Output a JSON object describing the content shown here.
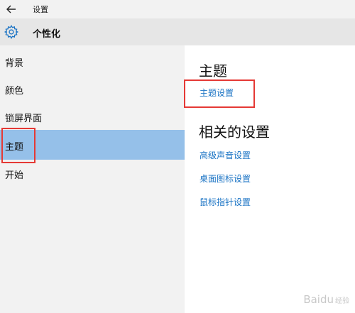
{
  "window": {
    "title": "设置"
  },
  "header": {
    "title": "个性化"
  },
  "sidebar": {
    "items": [
      {
        "label": "背景"
      },
      {
        "label": "颜色"
      },
      {
        "label": "锁屏界面"
      },
      {
        "label": "主题"
      },
      {
        "label": "开始"
      }
    ],
    "selected": "主题"
  },
  "main": {
    "section_title": "主题",
    "theme_settings_link": "主题设置",
    "related_title": "相关的设置",
    "related_links": [
      "高级声音设置",
      "桌面图标设置",
      "鼠标指针设置"
    ]
  },
  "watermark": {
    "text": "Baidu",
    "suffix": "经验"
  },
  "colors": {
    "selected_bg": "#95c0e9",
    "link": "#1a73c4",
    "annotation": "#e53935"
  },
  "icons": {
    "back": "arrow-left-icon",
    "settings": "gear-icon"
  }
}
